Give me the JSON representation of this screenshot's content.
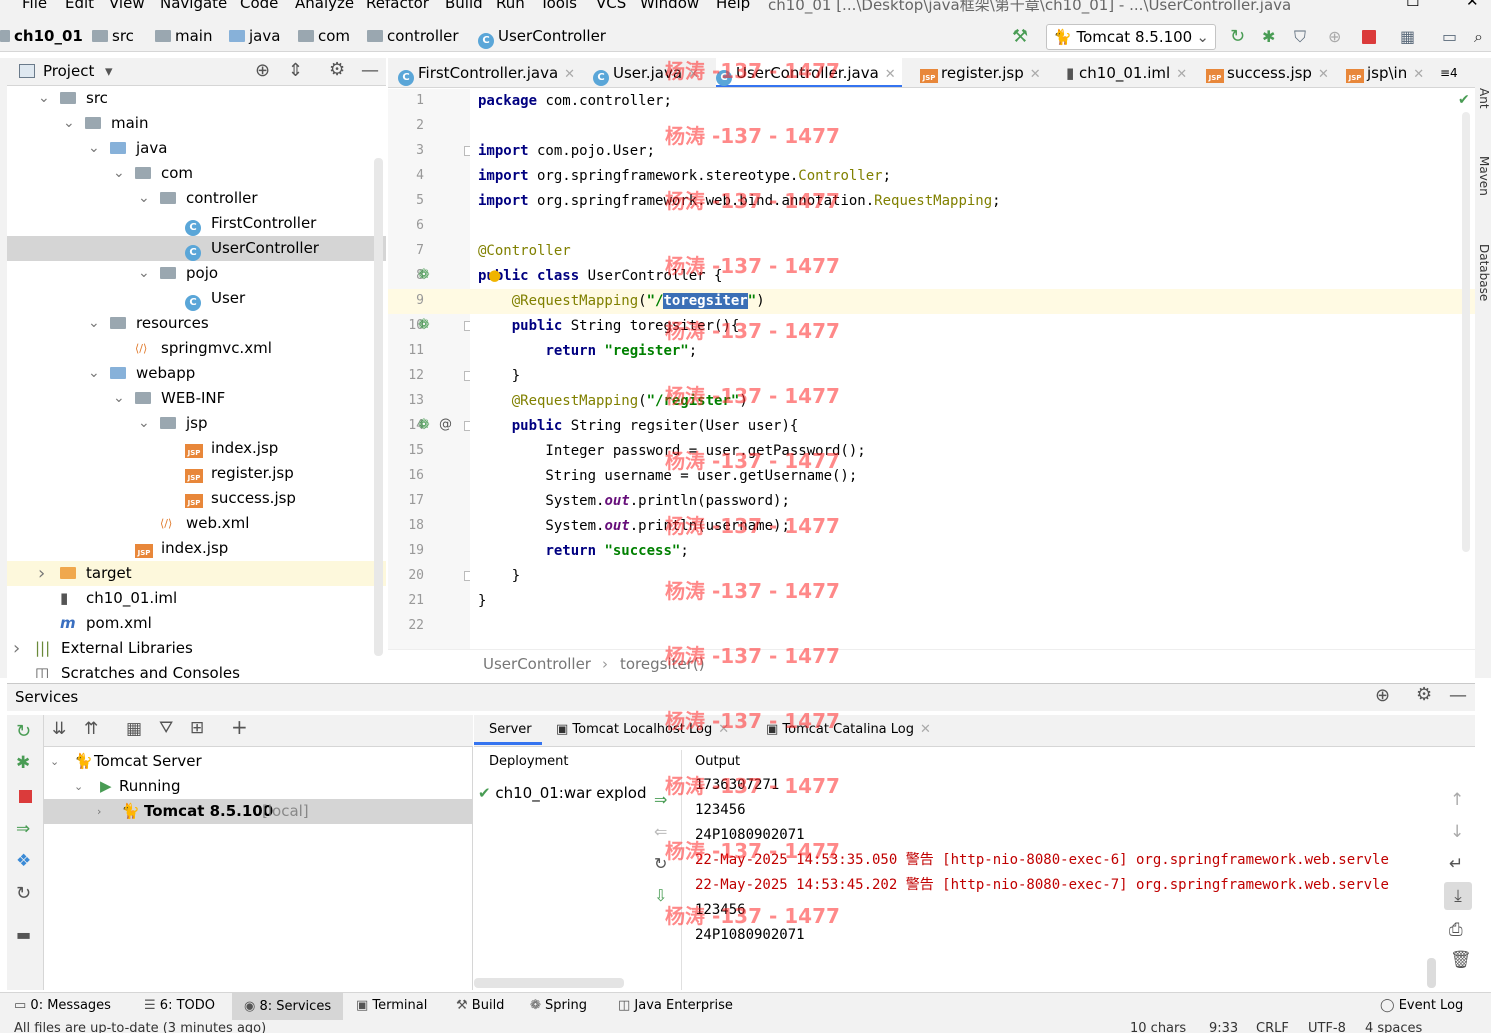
{
  "menu": [
    "File",
    "Edit",
    "View",
    "Navigate",
    "Code",
    "Analyze",
    "Refactor",
    "Build",
    "Run",
    "Tools",
    "VCS",
    "Window",
    "Help"
  ],
  "window_title": "ch10_01 [...\\Desktop\\java框架\\第十章\\ch10_01] - ...\\UserController.java",
  "breadcrumb": [
    "ch10_01",
    "src",
    "main",
    "java",
    "com",
    "controller",
    "UserController"
  ],
  "run_config": "Tomcat 8.5.100",
  "project_panel": {
    "title": "Project"
  },
  "tree": [
    {
      "label": "src",
      "depth": 1,
      "icon": "folder",
      "open": true
    },
    {
      "label": "main",
      "depth": 2,
      "icon": "folder",
      "open": true
    },
    {
      "label": "java",
      "depth": 3,
      "icon": "folder-blue",
      "open": true
    },
    {
      "label": "com",
      "depth": 4,
      "icon": "package",
      "open": true
    },
    {
      "label": "controller",
      "depth": 5,
      "icon": "package",
      "open": true
    },
    {
      "label": "FirstController",
      "depth": 6,
      "icon": "class"
    },
    {
      "label": "UserController",
      "depth": 6,
      "icon": "class",
      "selected": true
    },
    {
      "label": "pojo",
      "depth": 5,
      "icon": "package",
      "open": true
    },
    {
      "label": "User",
      "depth": 6,
      "icon": "class"
    },
    {
      "label": "resources",
      "depth": 3,
      "icon": "folder",
      "open": true
    },
    {
      "label": "springmvc.xml",
      "depth": 4,
      "icon": "xml"
    },
    {
      "label": "webapp",
      "depth": 3,
      "icon": "folder-web",
      "open": true
    },
    {
      "label": "WEB-INF",
      "depth": 4,
      "icon": "folder",
      "open": true
    },
    {
      "label": "jsp",
      "depth": 5,
      "icon": "folder",
      "open": true
    },
    {
      "label": "index.jsp",
      "depth": 6,
      "icon": "jsp"
    },
    {
      "label": "register.jsp",
      "depth": 6,
      "icon": "jsp"
    },
    {
      "label": "success.jsp",
      "depth": 6,
      "icon": "jsp"
    },
    {
      "label": "web.xml",
      "depth": 5,
      "icon": "xml"
    },
    {
      "label": "index.jsp",
      "depth": 4,
      "icon": "jsp"
    },
    {
      "label": "target",
      "depth": 1,
      "icon": "folder-orange",
      "open": false,
      "highlight": true
    },
    {
      "label": "ch10_01.iml",
      "depth": 1,
      "icon": "iml"
    },
    {
      "label": "pom.xml",
      "depth": 1,
      "icon": "maven"
    },
    {
      "label": "External Libraries",
      "depth": 0,
      "icon": "library",
      "open": false
    },
    {
      "label": "Scratches and Consoles",
      "depth": 0,
      "icon": "scratch"
    }
  ],
  "editor_tabs": [
    {
      "label": "FirstController.java",
      "icon": "class"
    },
    {
      "label": "User.java",
      "icon": "class"
    },
    {
      "label": "UserController.java",
      "icon": "class",
      "active": true
    },
    {
      "label": "register.jsp",
      "icon": "jsp"
    },
    {
      "label": "ch10_01.iml",
      "icon": "iml"
    },
    {
      "label": "success.jsp",
      "icon": "jsp"
    },
    {
      "label": "jsp\\in",
      "icon": "jsp"
    }
  ],
  "tabs_overflow": "4",
  "code_lines": [
    "package com.controller;",
    "",
    "import com.pojo.User;",
    "import org.springframework.stereotype.Controller;",
    "import org.springframework.web.bind.annotation.RequestMapping;",
    "",
    "@Controller",
    "public class UserController {",
    "    @RequestMapping(\"/toregsiter\")",
    "    public String toregsiter(){",
    "        return \"register\";",
    "    }",
    "    @RequestMapping(\"/register\")",
    "    public String regsiter(User user){",
    "        Integer password = user.getPassword();",
    "        String username = user.getUsername();",
    "        System.out.println(password);",
    "        System.out.println(username);",
    "        return \"success\";",
    "    }",
    "}",
    ""
  ],
  "editor_breadcrumb": [
    "UserController",
    "toregsiter()"
  ],
  "right_strip": [
    "Ant",
    "Maven",
    "Database"
  ],
  "services": {
    "title": "Services",
    "tree": [
      {
        "label": "Tomcat Server",
        "depth": 0
      },
      {
        "label": "Running",
        "depth": 1
      },
      {
        "label": "Tomcat 8.5.100",
        "suffix": "[local]",
        "depth": 2,
        "selected": true
      }
    ],
    "tabs": [
      "Server",
      "Tomcat Localhost Log",
      "Tomcat Catalina Log"
    ],
    "deployment_header": "Deployment",
    "output_header": "Output",
    "deployment_item": "ch10_01:war explod",
    "output_lines": [
      {
        "text": "1736307271",
        "kind": "normal"
      },
      {
        "text": "123456",
        "kind": "normal"
      },
      {
        "text": "24P1080902071",
        "kind": "normal"
      },
      {
        "text": "22-May-2025 14:53:35.050 警告 [http-nio-8080-exec-6] org.springframework.web.servle",
        "kind": "warn"
      },
      {
        "text": "22-May-2025 14:53:45.202 警告 [http-nio-8080-exec-7] org.springframework.web.servle",
        "kind": "warn"
      },
      {
        "text": "123456",
        "kind": "normal"
      },
      {
        "text": "24P1080902071",
        "kind": "normal"
      }
    ]
  },
  "bottom_tabs": [
    {
      "label": "0: Messages"
    },
    {
      "label": "6: TODO"
    },
    {
      "label": "8: Services",
      "active": true
    },
    {
      "label": "Terminal"
    },
    {
      "label": "Build"
    },
    {
      "label": "Spring"
    },
    {
      "label": "Java Enterprise"
    }
  ],
  "event_log": "Event Log",
  "status": {
    "message": "All files are up-to-date (3 minutes ago)",
    "chars": "10 chars",
    "position": "9:33",
    "line_sep": "CRLF",
    "encoding": "UTF-8",
    "indent": "4 spaces"
  },
  "watermark": "杨涛 -137 - 1477",
  "colors": {
    "accent": "#3574f0",
    "selection": "#d5d5d5",
    "highlight_line": "#fffae3",
    "run_green": "#499c54",
    "stop_red": "#db3b3b"
  }
}
